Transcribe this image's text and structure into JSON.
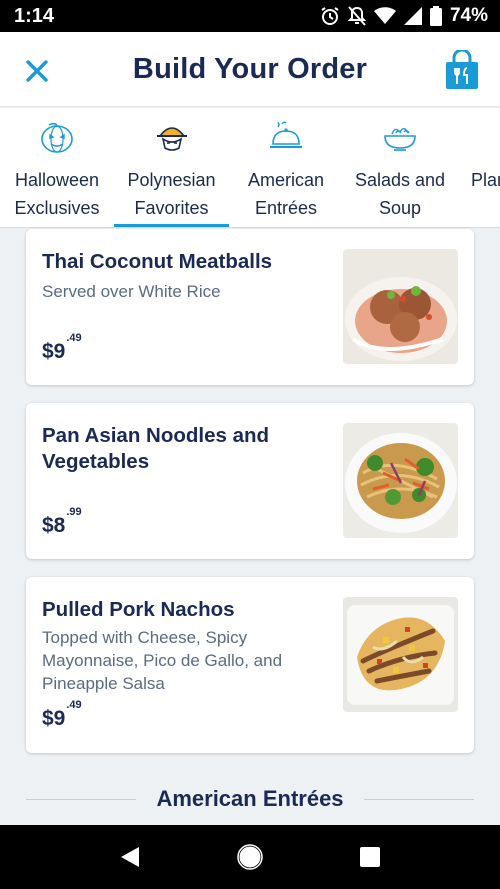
{
  "status": {
    "time": "1:14",
    "battery": "74%"
  },
  "header": {
    "title": "Build Your Order"
  },
  "categories": [
    {
      "label": "Halloween\nExclusives",
      "icon": "pumpkin-icon"
    },
    {
      "label": "Polynesian\nFavorites",
      "icon": "tiki-dish-icon"
    },
    {
      "label": "American\nEntrées",
      "icon": "cloche-icon"
    },
    {
      "label": "Salads and\nSoup",
      "icon": "salad-bowl-icon"
    },
    {
      "label": "Plan",
      "icon": ""
    }
  ],
  "items": [
    {
      "name": "Thai Coconut Meatballs",
      "description": "Served over White Rice",
      "price_dollars": "$9",
      "price_cents": ".49"
    },
    {
      "name": "Pan Asian Noodles and Vegetables",
      "description": "",
      "price_dollars": "$8",
      "price_cents": ".99"
    },
    {
      "name": "Pulled Pork Nachos",
      "description": "Topped with Cheese, Spicy Mayonnaise, Pico de Gallo, and Pineapple Salsa",
      "price_dollars": "$9",
      "price_cents": ".49"
    }
  ],
  "next_section": {
    "title": "American Entrées"
  },
  "colors": {
    "accent": "#1a9bd7",
    "title": "#1b2a55",
    "muted": "#5c6b80"
  }
}
